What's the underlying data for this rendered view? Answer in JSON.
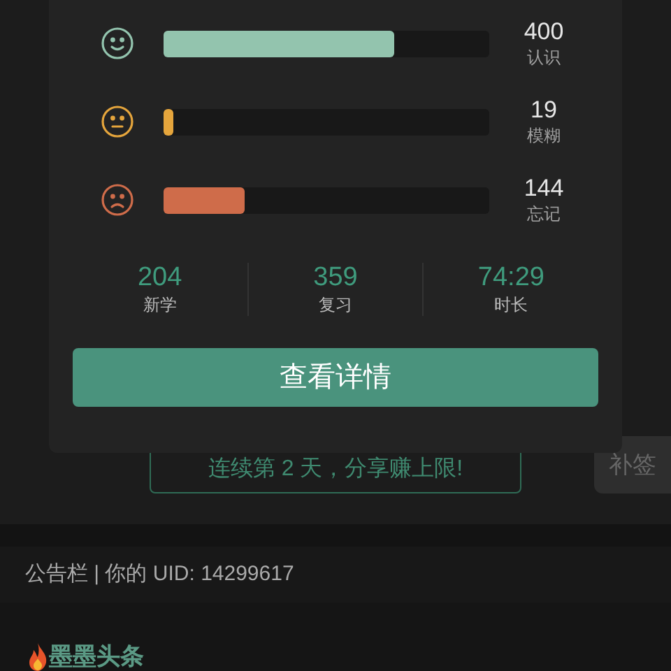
{
  "popup": {
    "rows": [
      {
        "kind": "happy",
        "color": "#93c4ae",
        "level": 0.71,
        "count": "400",
        "label": "认识"
      },
      {
        "kind": "neutral",
        "color": "#e5a53c",
        "level": 0.03,
        "count": "19",
        "label": "模糊"
      },
      {
        "kind": "sad",
        "color": "#cf6c4a",
        "level": 0.25,
        "count": "144",
        "label": "忘记"
      }
    ],
    "stats": [
      {
        "value": "204",
        "label": "新学"
      },
      {
        "value": "359",
        "label": "复习"
      },
      {
        "value": "74:29",
        "label": "时长"
      }
    ],
    "button": "查看详情"
  },
  "share_button": "连续第 2 天，分享赚上限!",
  "makeup_button": "补签",
  "notice": "公告栏 | 你的 UID: 14299617",
  "headline": "墨墨头条"
}
